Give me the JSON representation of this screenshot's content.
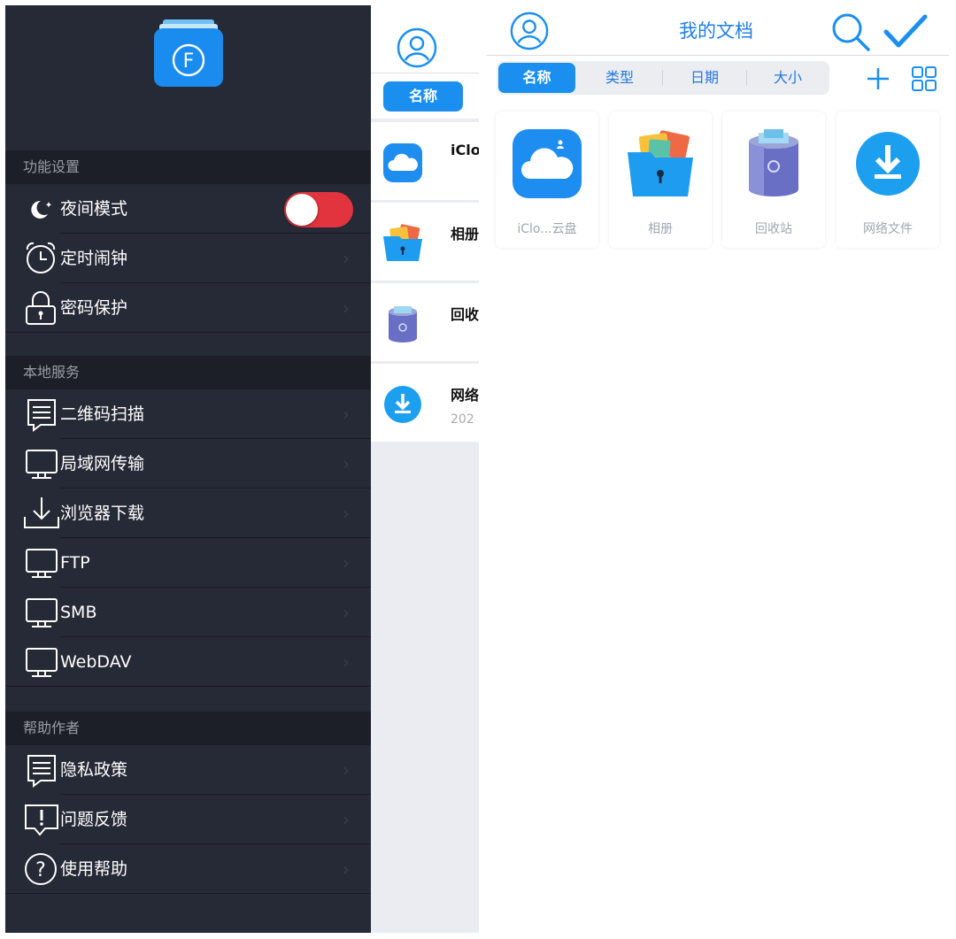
{
  "drawer": {
    "sections": [
      {
        "header": "功能设置"
      },
      {
        "header": "本地服务"
      },
      {
        "header": "帮助作者"
      }
    ],
    "items": [
      {
        "label": "夜间模式",
        "icon": "moon-icon",
        "toggle_on": true
      },
      {
        "label": "定时闹钟",
        "icon": "alarm-clock-icon"
      },
      {
        "label": "密码保护",
        "icon": "lock-icon"
      },
      {
        "label": "二维码扫描",
        "icon": "document-icon"
      },
      {
        "label": "局域网传输",
        "icon": "monitor-icon"
      },
      {
        "label": "浏览器下载",
        "icon": "download-icon"
      },
      {
        "label": "FTP",
        "icon": "monitor-icon"
      },
      {
        "label": "SMB",
        "icon": "monitor-icon"
      },
      {
        "label": "WebDAV",
        "icon": "monitor-icon"
      },
      {
        "label": "隐私政策",
        "icon": "document-icon"
      },
      {
        "label": "问题反馈",
        "icon": "feedback-icon"
      },
      {
        "label": "使用帮助",
        "icon": "help-icon"
      }
    ],
    "chevron": "›",
    "logo_letter": "F"
  },
  "mid": {
    "sort_active": "名称",
    "rows": [
      {
        "name": "iClo",
        "icon": "cloud-icon"
      },
      {
        "name": "相册",
        "icon": "album-icon"
      },
      {
        "name": "回收",
        "icon": "trash-icon"
      },
      {
        "name": "网络",
        "date": "202",
        "icon": "download-circle-icon"
      }
    ]
  },
  "main": {
    "title": "我的文档",
    "sort_tabs": [
      "名称",
      "类型",
      "日期",
      "大小"
    ],
    "active_tab": 0,
    "tiles": [
      {
        "label": "iClo...云盘",
        "icon": "cloud-icon"
      },
      {
        "label": "相册",
        "icon": "album-icon"
      },
      {
        "label": "回收站",
        "icon": "trash-icon"
      },
      {
        "label": "网络文件",
        "icon": "download-circle-icon"
      }
    ]
  },
  "colors": {
    "accent": "#1b8fef",
    "drawer_bg": "#262936",
    "section_bg": "#1d1f28",
    "toggle_on": "#e2343f"
  }
}
